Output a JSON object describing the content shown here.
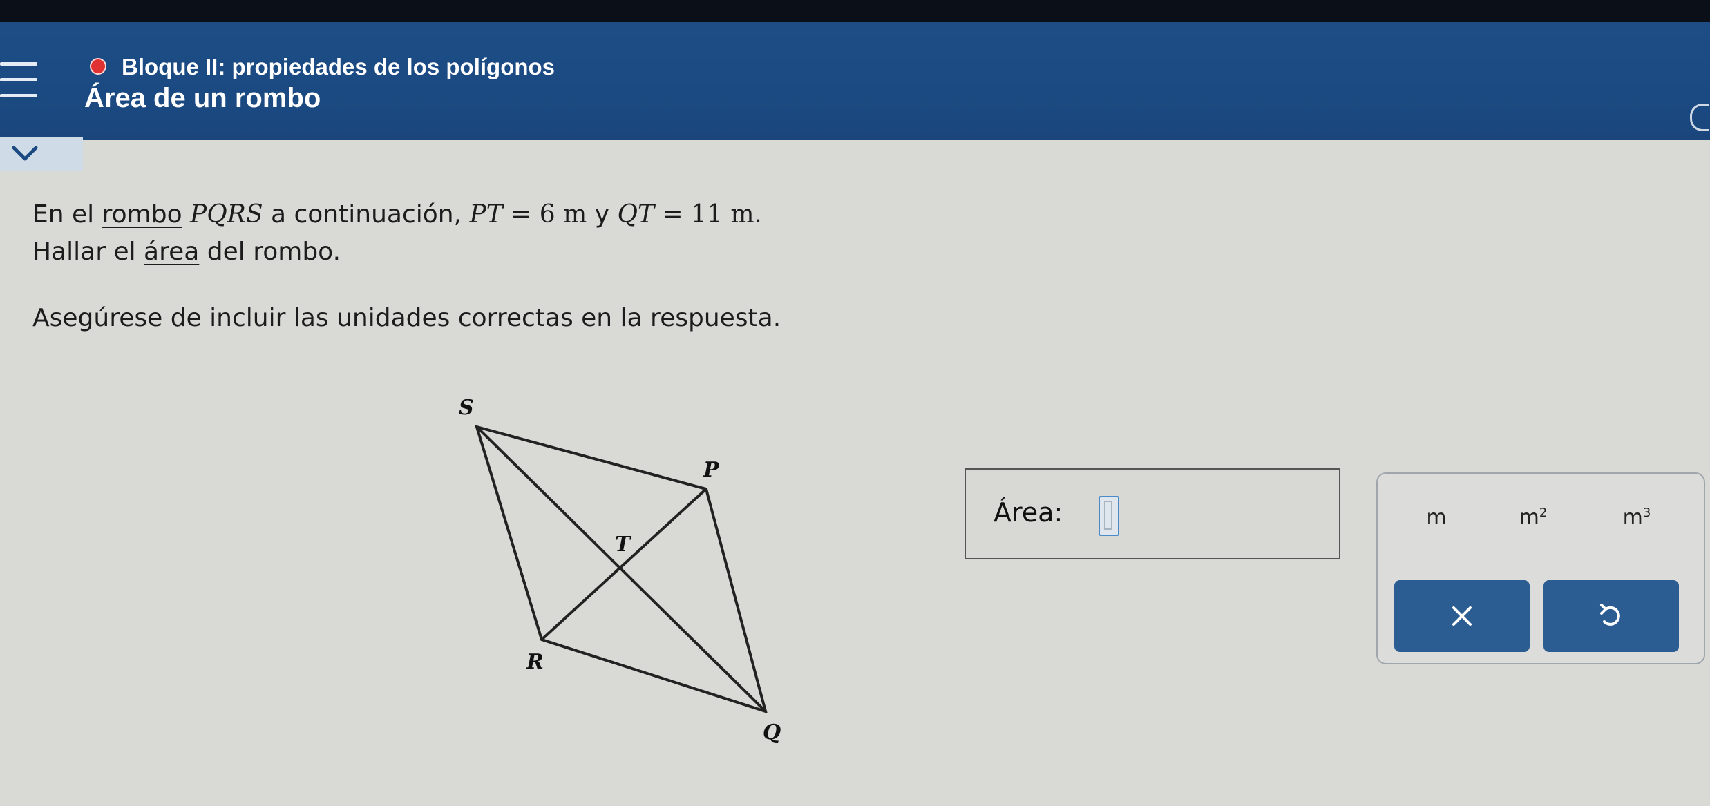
{
  "header": {
    "section": "Bloque II: propiedades de los polígonos",
    "topic": "Área de un rombo",
    "colors": {
      "bar": "#1e4d86",
      "status_dot": "#e03232"
    }
  },
  "problem": {
    "line1": {
      "prefix": "En el ",
      "link": "rombo",
      "sp": " ",
      "shape": "PQRS",
      "mid": " a continuación, ",
      "seg1": "PT",
      "eq1": " = 6 ",
      "unit1": "m",
      "y": " y ",
      "seg2": "QT",
      "eq2": " = 11 ",
      "unit2": "m",
      "end": "."
    },
    "line2": {
      "prefix": "Hallar el ",
      "link": "área",
      "suffix": " del rombo."
    },
    "line3": "Asegúrese de incluir las unidades correctas en la respuesta."
  },
  "diagram": {
    "labels": {
      "S": "S",
      "P": "P",
      "T": "T",
      "R": "R",
      "Q": "Q"
    }
  },
  "answer": {
    "label": "Área:",
    "value": ""
  },
  "units": {
    "m": "m",
    "m2_base": "m",
    "m2_exp": "2",
    "m3_base": "m",
    "m3_exp": "3"
  },
  "actions": {
    "clear_icon": "close-icon",
    "undo_icon": "undo-icon",
    "button_color": "#2b5d92"
  }
}
